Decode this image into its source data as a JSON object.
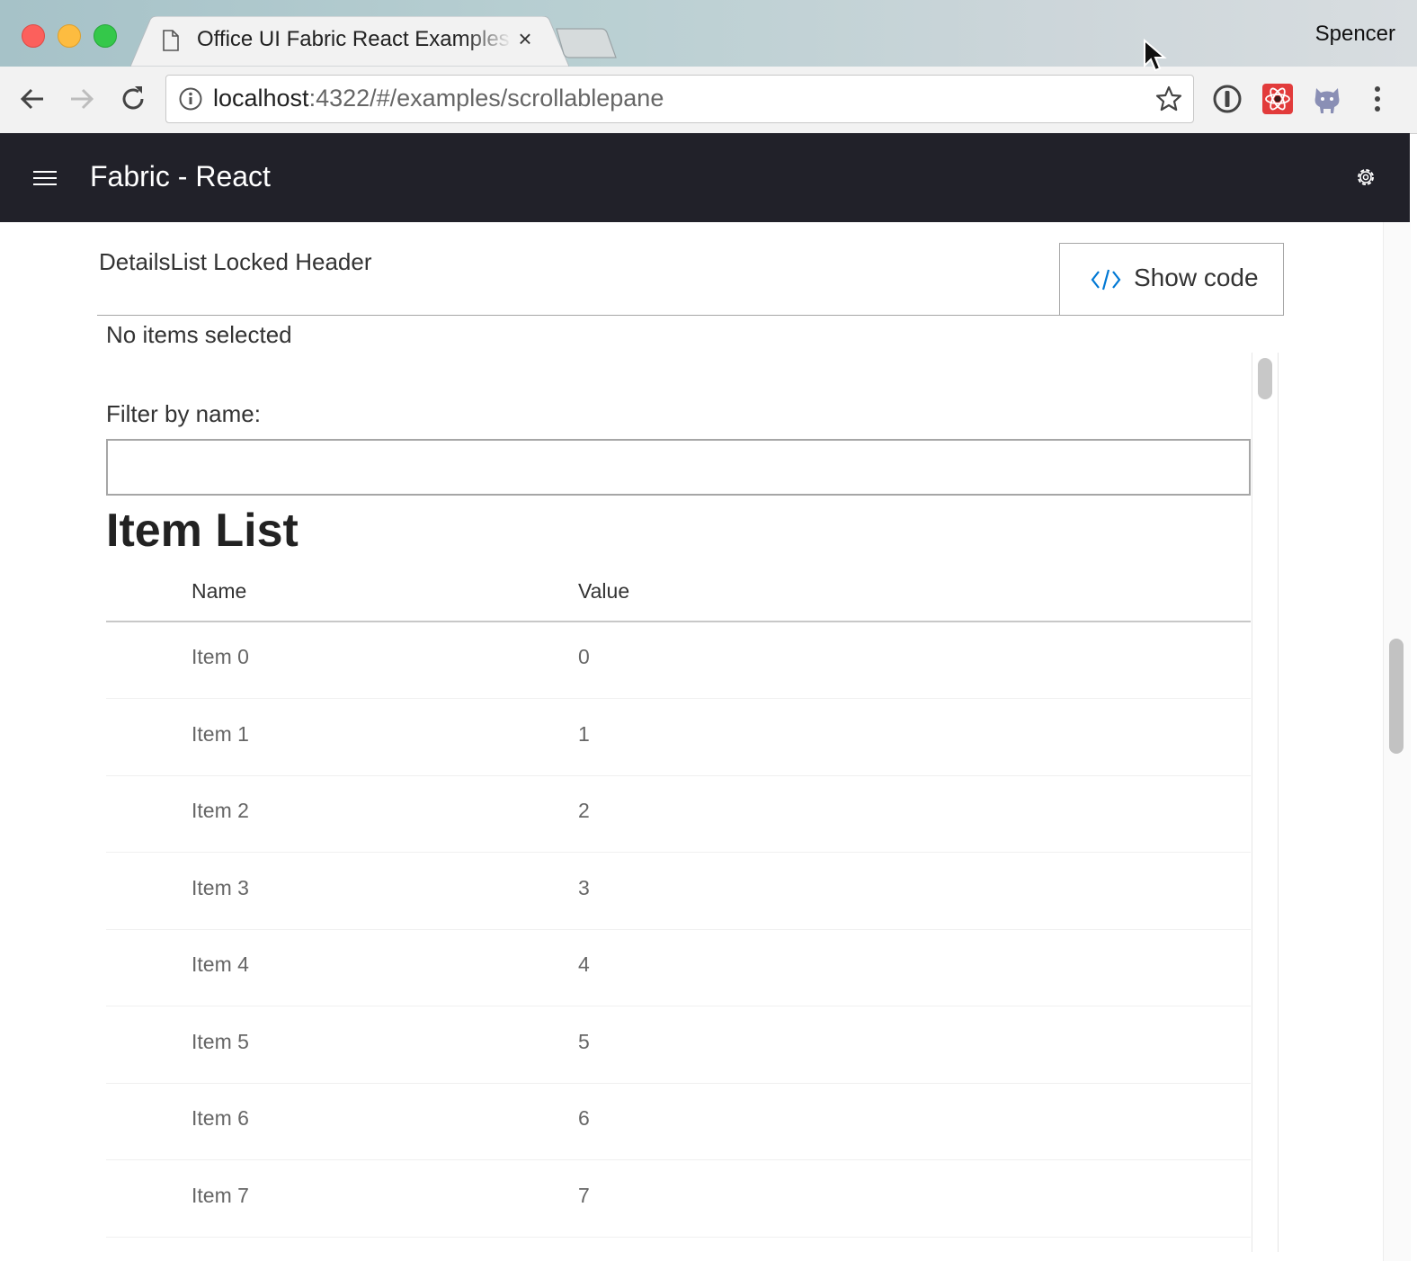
{
  "browser": {
    "tab_title": "Office UI Fabric React Examples",
    "profile_name": "Spencer",
    "url_host": "localhost",
    "url_rest": ":4322/#/examples/scrollablepane"
  },
  "app": {
    "title": "Fabric - React"
  },
  "example": {
    "title": "DetailsList Locked Header",
    "show_code_label": "Show code",
    "selection_text": "No items selected",
    "filter_label": "Filter by name:",
    "filter_value": "",
    "list_heading": "Item List",
    "columns": [
      "Name",
      "Value"
    ],
    "rows": [
      {
        "name": "Item 0",
        "value": "0"
      },
      {
        "name": "Item 1",
        "value": "1"
      },
      {
        "name": "Item 2",
        "value": "2"
      },
      {
        "name": "Item 3",
        "value": "3"
      },
      {
        "name": "Item 4",
        "value": "4"
      },
      {
        "name": "Item 5",
        "value": "5"
      },
      {
        "name": "Item 6",
        "value": "6"
      },
      {
        "name": "Item 7",
        "value": "7"
      }
    ]
  },
  "icons": {
    "tab": "page-icon",
    "nav": [
      "back-arrow-icon",
      "forward-arrow-icon",
      "reload-icon"
    ],
    "omnibox": [
      "info-icon",
      "star-icon"
    ],
    "extensions": [
      "1password-icon",
      "react-devtools-icon",
      "octocat-icon",
      "kebab-menu-icon"
    ],
    "header": [
      "hamburger-icon",
      "gear-icon"
    ],
    "button": "code-icon"
  },
  "colors": {
    "header_bg": "#212129",
    "code_icon": "#0078d4"
  }
}
